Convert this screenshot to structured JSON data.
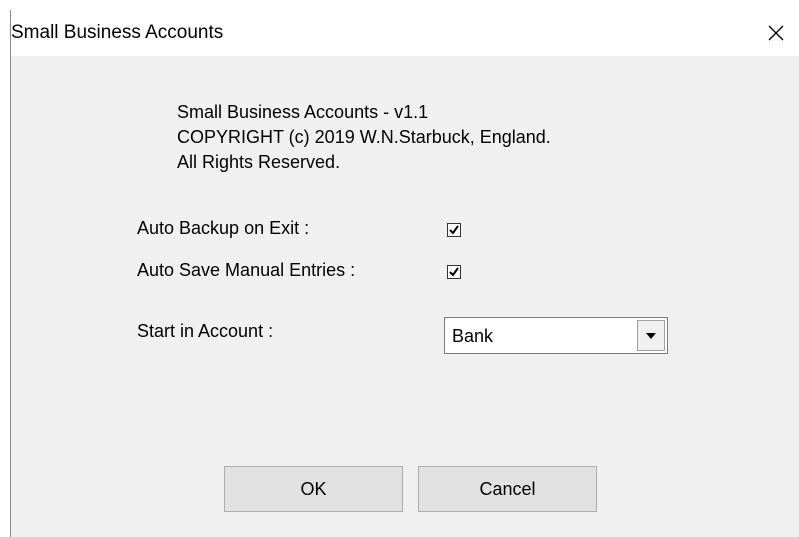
{
  "window": {
    "title": "Small Business Accounts",
    "close_icon": "close-icon"
  },
  "about": {
    "line1": "Small Business Accounts - v1.1",
    "line2": "COPYRIGHT (c) 2019 W.N.Starbuck, England.",
    "line3": "All Rights Reserved."
  },
  "options": {
    "auto_backup_label": "Auto Backup on Exit :",
    "auto_backup_checked": true,
    "auto_save_label": "Auto Save Manual Entries :",
    "auto_save_checked": true,
    "start_account_label": "Start in Account :",
    "start_account_value": "Bank"
  },
  "buttons": {
    "ok_label": "OK",
    "cancel_label": "Cancel"
  }
}
